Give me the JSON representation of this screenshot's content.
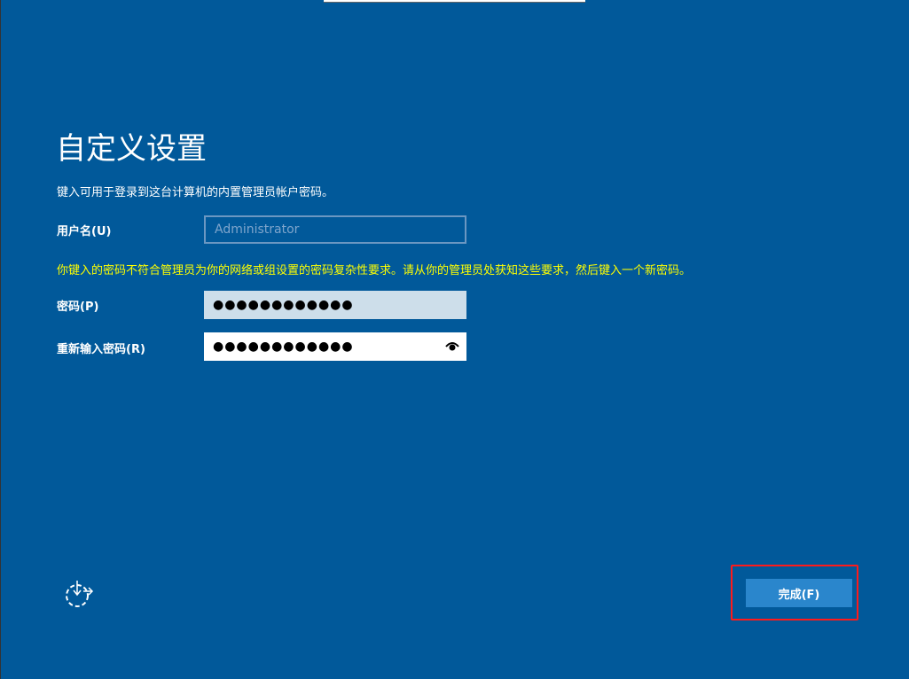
{
  "title": "自定义设置",
  "description": "键入可用于登录到这台计算机的内置管理员帐户密码。",
  "username": {
    "label": "用户名(U)",
    "value": "Administrator"
  },
  "warning": "你键入的密码不符合管理员为你的网络或组设置的密码复杂性要求。请从你的管理员处获知这些要求，然后键入一个新密码。",
  "password": {
    "label": "密码(P)",
    "value": "●●●●●●●●●●●●"
  },
  "confirm_password": {
    "label": "重新输入密码(R)",
    "value": "●●●●●●●●●●●●"
  },
  "finish_label": "完成(F)",
  "colors": {
    "background": "#01599a",
    "warning": "#ffff00",
    "button": "#2a86cc",
    "highlight": "#ff1a1a"
  }
}
